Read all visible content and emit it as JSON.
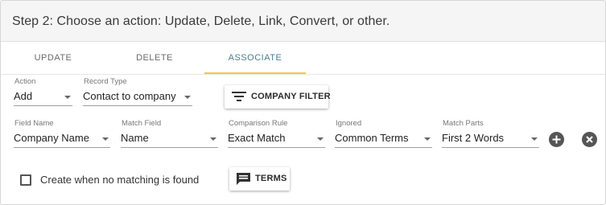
{
  "header": {
    "title": "Step 2: Choose an action: Update, Delete, Link, Convert, or other."
  },
  "tabs": [
    {
      "label": "UPDATE",
      "active": false
    },
    {
      "label": "DELETE",
      "active": false
    },
    {
      "label": "ASSOCIATE",
      "active": true
    }
  ],
  "row1": {
    "action": {
      "label": "Action",
      "value": "Add"
    },
    "record_type": {
      "label": "Record Type",
      "value": "Contact to company"
    },
    "company_filter_button": {
      "label": "COMPANY FILTER",
      "icon": "filter-list-icon"
    }
  },
  "row2": {
    "field_name": {
      "label": "Field Name",
      "value": "Company Name"
    },
    "match_field": {
      "label": "Match Field",
      "value": "Name"
    },
    "comparison_rule": {
      "label": "Comparison Rule",
      "value": "Exact Match"
    },
    "ignored": {
      "label": "Ignored",
      "value": "Common Terms"
    },
    "match_parts": {
      "label": "Match Parts",
      "value": "First 2 Words"
    },
    "add_icon": "plus-circle-icon",
    "remove_icon": "close-circle-icon"
  },
  "row3": {
    "create_checkbox": {
      "label": "Create when no matching is found",
      "checked": false
    },
    "terms_button": {
      "label": "TERMS",
      "icon": "message-text-icon"
    }
  },
  "colors": {
    "accent_underline": "#f0c84a",
    "active_tab": "#4a7e93",
    "header_bg": "#f5f5f6"
  }
}
